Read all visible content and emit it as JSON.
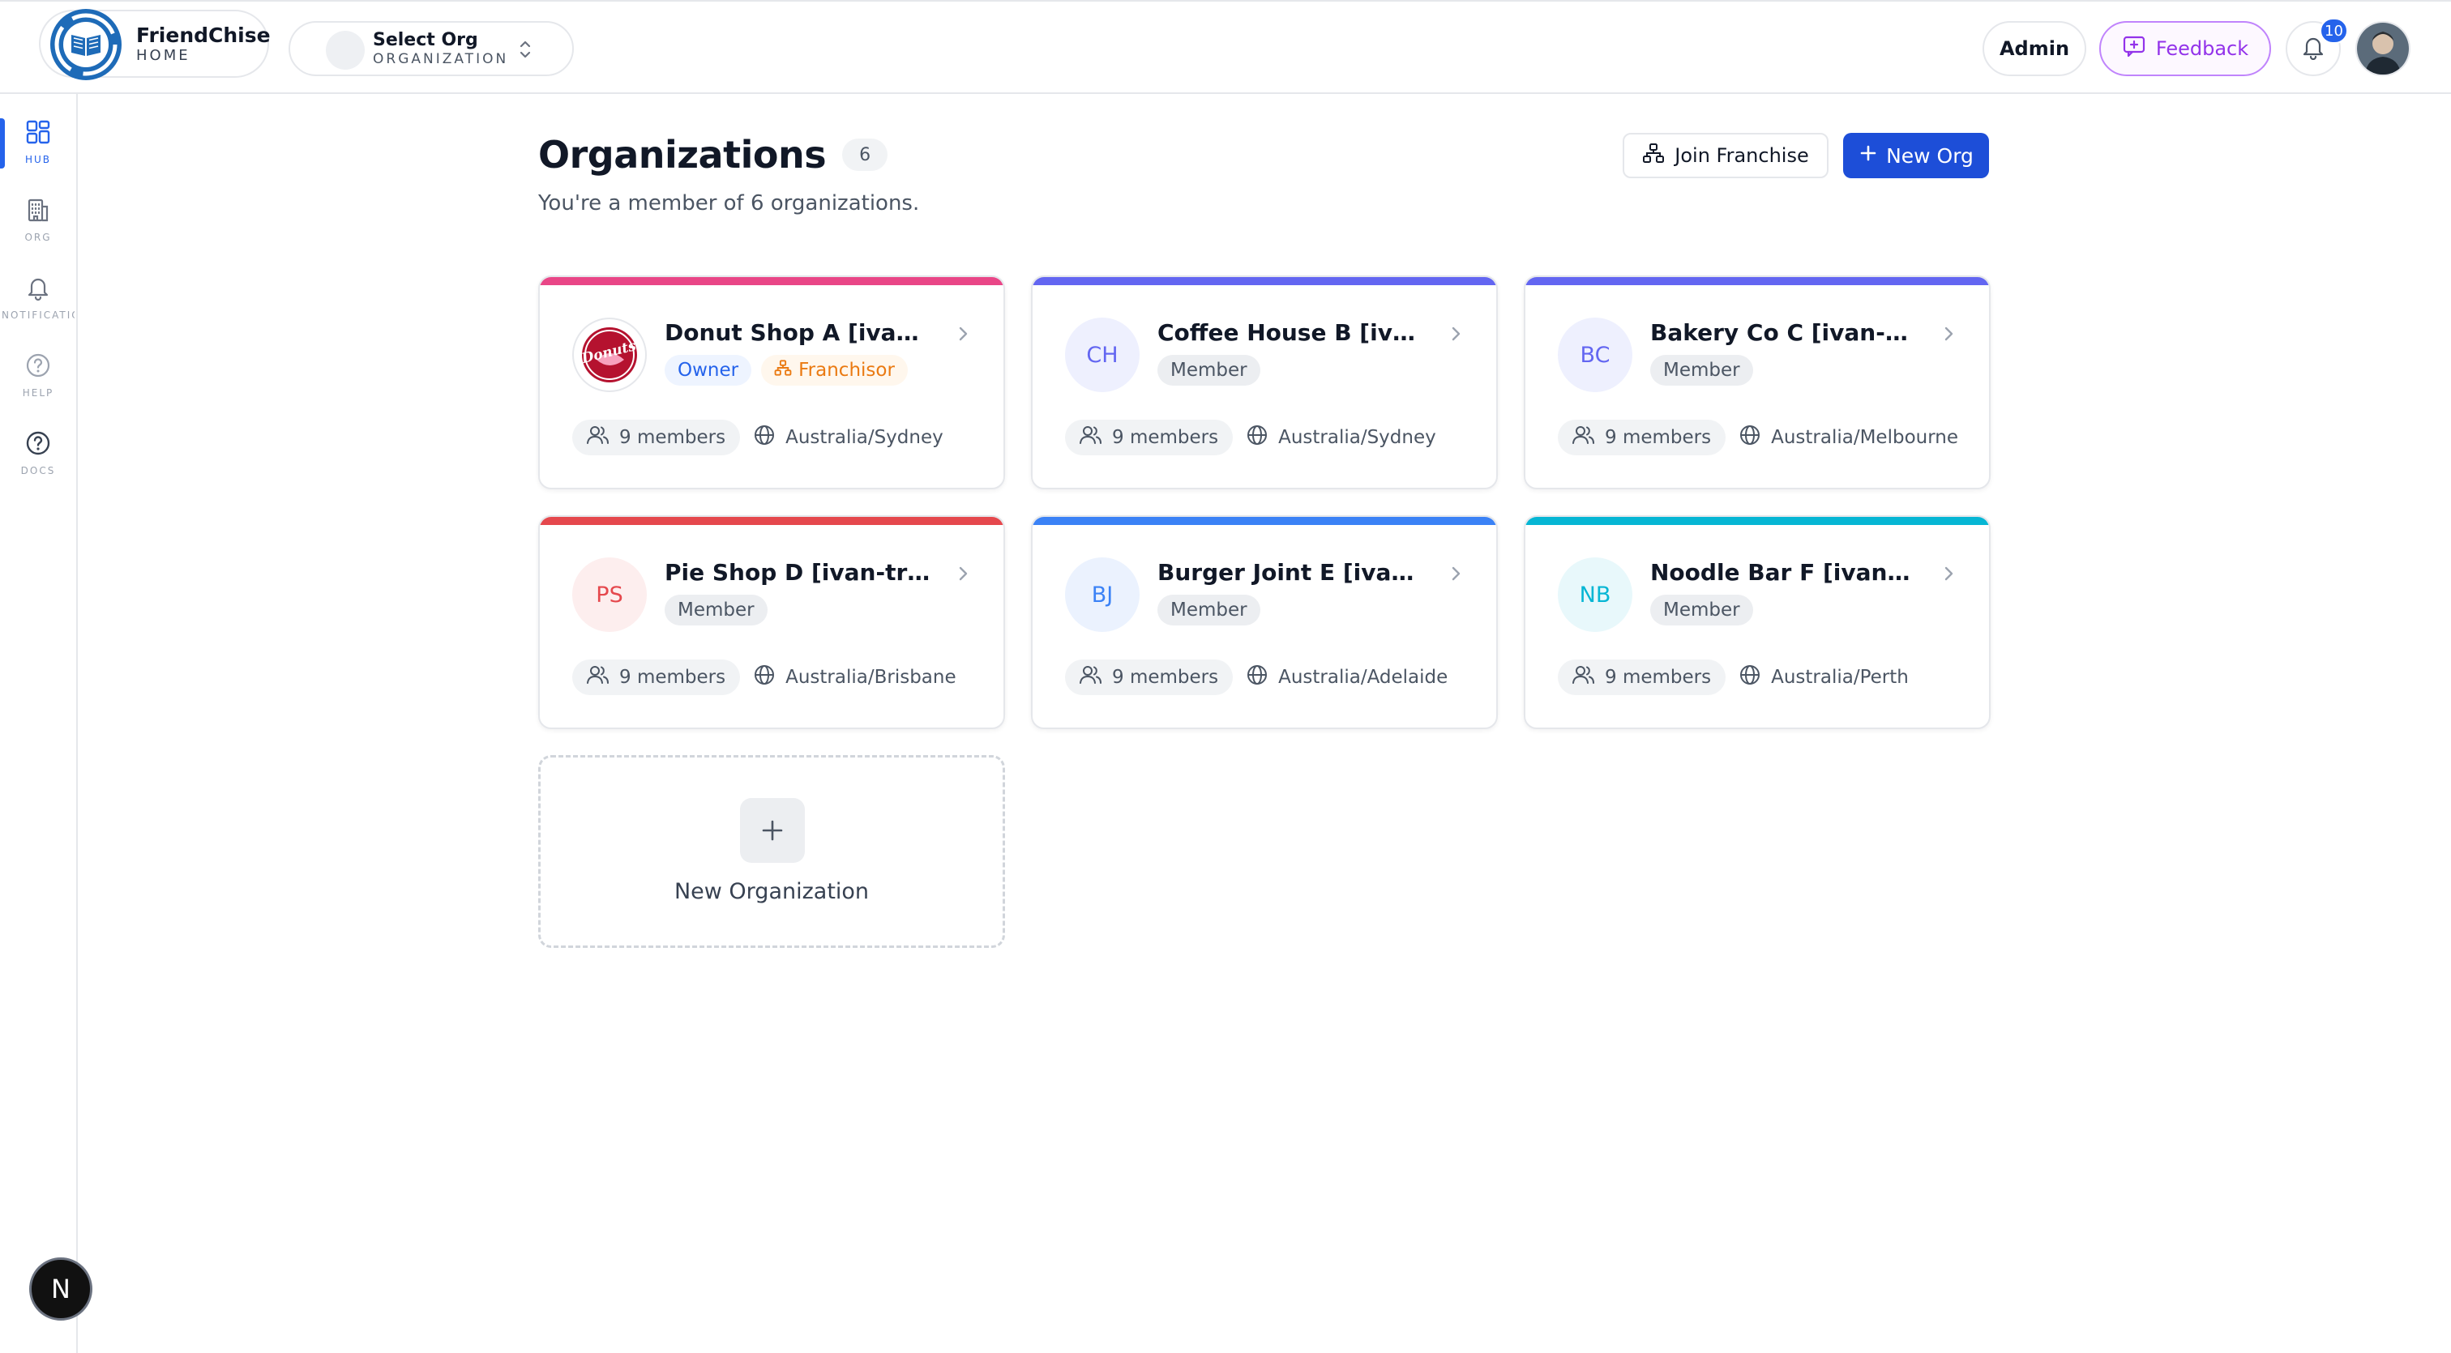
{
  "topbar": {
    "brand": {
      "name": "FriendChise",
      "sub": "HOME",
      "icon": "book-recycle-logo-icon"
    },
    "org_select": {
      "title": "Select Org",
      "sub": "ORGANIZATION"
    },
    "admin_label": "Admin",
    "feedback_label": "Feedback",
    "notification_count": "10"
  },
  "sidebar": {
    "items": [
      {
        "label": "HUB",
        "icon": "grid-icon",
        "active": true
      },
      {
        "label": "ORG",
        "icon": "building-icon",
        "active": false
      },
      {
        "label": "NOTIFICATIONS",
        "icon": "bell-icon",
        "active": false
      },
      {
        "label": "HELP",
        "icon": "help-circle-icon",
        "active": false
      },
      {
        "label": "DOCS",
        "icon": "question-circle-icon",
        "active": false
      }
    ],
    "footer_badge": "N"
  },
  "main": {
    "title": "Organizations",
    "count": "6",
    "subtitle": "You're a member of 6 organizations.",
    "join_label": "Join Franchise",
    "new_org_label": "New Org",
    "orgs": [
      {
        "name": "Donut Shop A [ivan-tran]",
        "initials": "",
        "logo_text": "Donuts",
        "tags": [
          "Owner",
          "Franchisor"
        ],
        "members": "9 members",
        "timezone": "Australia/Sydney",
        "accent": "#e94687"
      },
      {
        "name": "Coffee House B [ivan-tran]",
        "initials": "CH",
        "tags": [
          "Member"
        ],
        "members": "9 members",
        "timezone": "Australia/Sydney",
        "accent": "#6366f1"
      },
      {
        "name": "Bakery Co C [ivan-tran]",
        "initials": "BC",
        "tags": [
          "Member"
        ],
        "members": "9 members",
        "timezone": "Australia/Melbourne",
        "accent": "#6366f1"
      },
      {
        "name": "Pie Shop D [ivan-tran]",
        "initials": "PS",
        "tags": [
          "Member"
        ],
        "members": "9 members",
        "timezone": "Australia/Brisbane",
        "accent": "#e5484d"
      },
      {
        "name": "Burger Joint E [ivan-tran]",
        "initials": "BJ",
        "tags": [
          "Member"
        ],
        "members": "9 members",
        "timezone": "Australia/Adelaide",
        "accent": "#3b82f6"
      },
      {
        "name": "Noodle Bar F [ivan-tran]",
        "initials": "NB",
        "tags": [
          "Member"
        ],
        "members": "9 members",
        "timezone": "Australia/Perth",
        "accent": "#06b6d4"
      }
    ],
    "new_org_card_label": "New Organization"
  },
  "colors": {
    "primary": "#1d4ed8",
    "feedback": "#9333ea",
    "owner_tag": "#2563eb",
    "franchisor_tag": "#ea7a12"
  }
}
